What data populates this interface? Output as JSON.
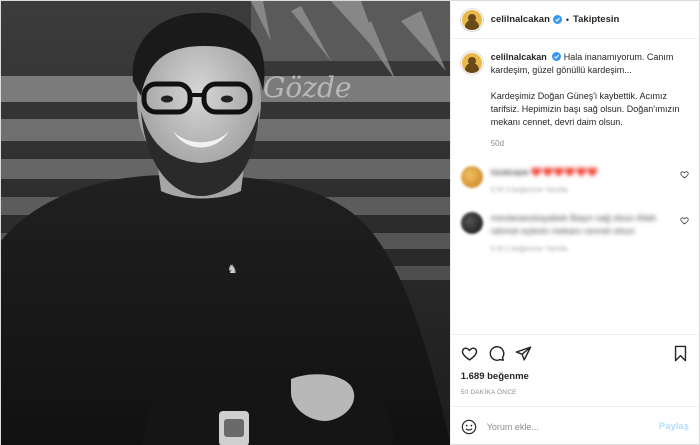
{
  "header": {
    "username": "celilnalcakan",
    "separator": "•",
    "follow_label": "Takiptesin"
  },
  "caption": {
    "username": "celilnalcakan",
    "line1": "Hala inanamıyorum. Canım kardeşim, güzel gönüllü kardeşim...",
    "line2": "Kardeşimiz Doğan Güneş'i kaybettik. Acımız tarifsiz. Hepimizin başı sağ olsun. Doğan'ımızın mekanı cennet, devri daim olsun.",
    "age": "50d"
  },
  "comments": [
    {
      "text": "k̶i̶z̶a̶l̶c̶a̶p̶e̶ ❤️❤️❤️❤️❤️❤️",
      "meta": "5 hf   3 beğenme   Yanıtla"
    },
    {
      "text": "mevlanaozkayabek  Başın sağ olsun Allah rahmet eylesin mekanı cennet olsun",
      "meta": "5 hf   2 beğenme   Yanıtla"
    }
  ],
  "likes": "1.689 beğenme",
  "posted": "50 DAKİKA ÖNCE",
  "input": {
    "placeholder": "Yorum ekle..."
  },
  "post_button": "Paylaş",
  "photo": {
    "sign_text": "Gözde"
  },
  "colors": {
    "verified": "#3897f0",
    "link_disabled": "#b2dffc",
    "muted": "#8e8e8e"
  },
  "icons": [
    "verified-badge-icon",
    "heart-icon",
    "comment-icon",
    "share-icon",
    "bookmark-icon",
    "emoji-icon"
  ]
}
